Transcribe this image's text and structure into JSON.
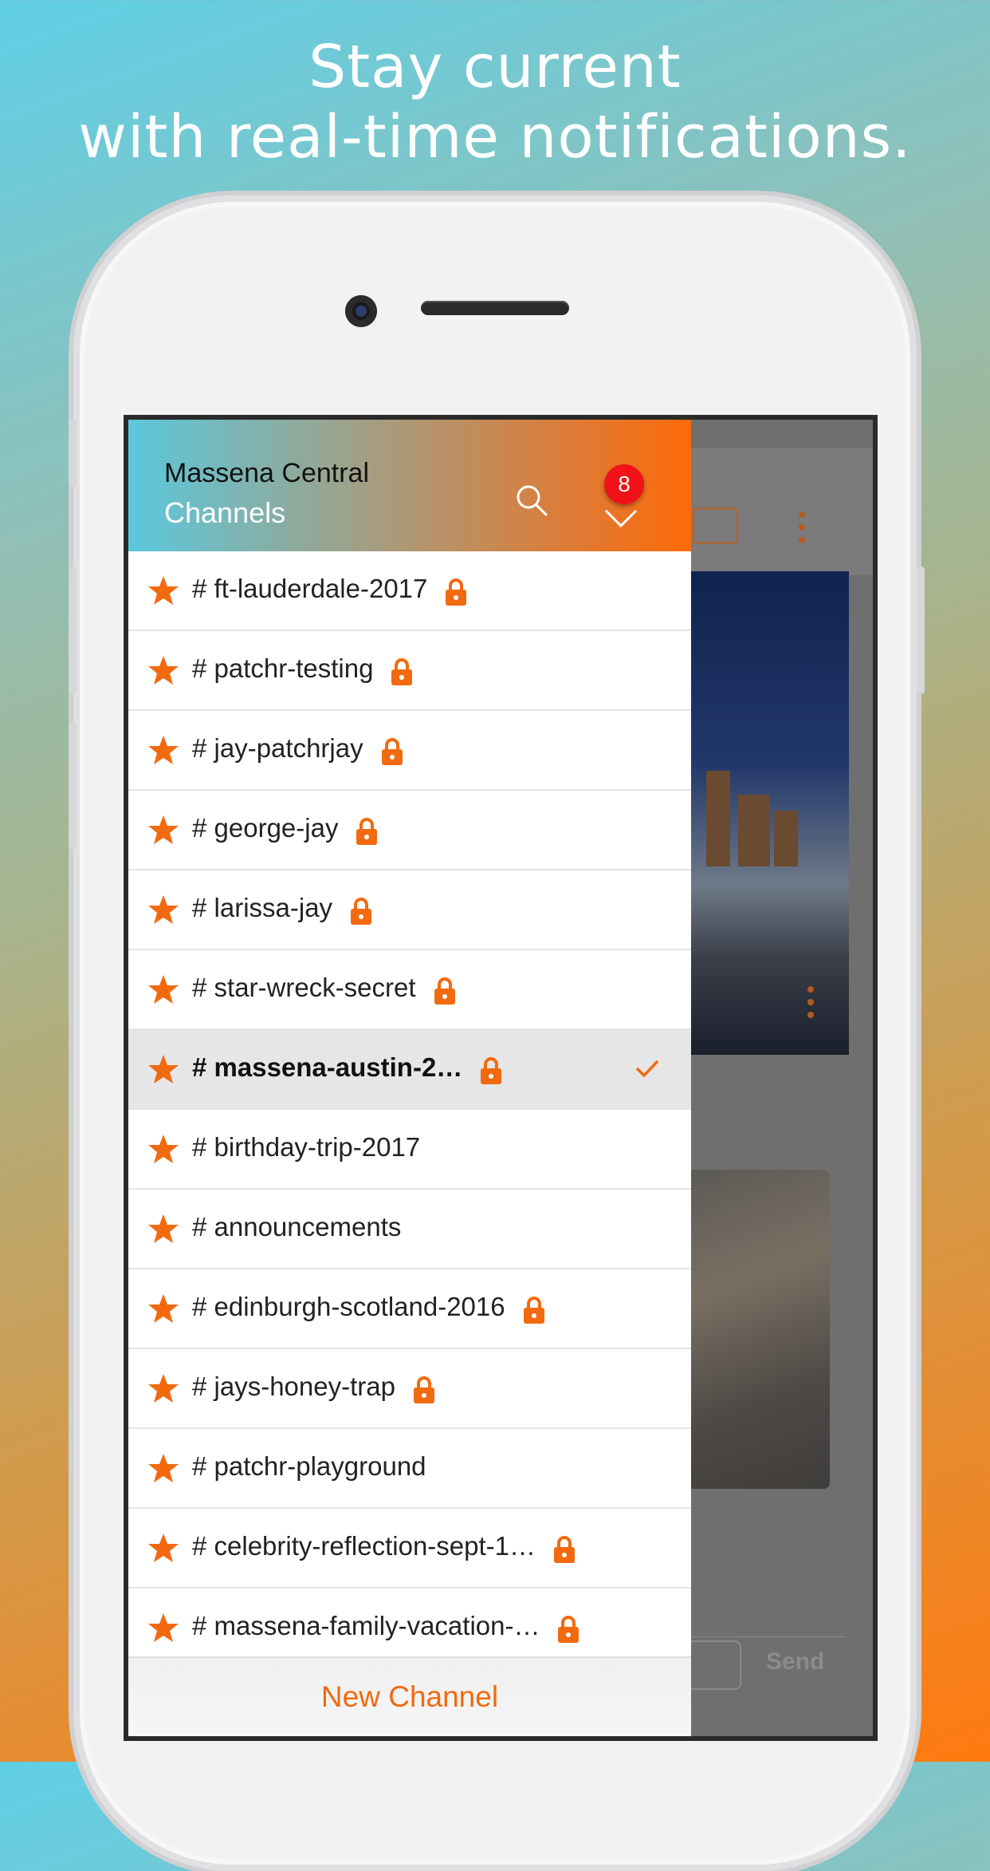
{
  "headline": {
    "line1": "Stay current",
    "line2": "with real-time notifications."
  },
  "drawer": {
    "team_name": "Massena Central",
    "section_title": "Channels",
    "notification_count": "8",
    "new_channel_label": "New Channel"
  },
  "background_app": {
    "send_label": "Send"
  },
  "channels": [
    {
      "label": "# ft-lauderdale-2017",
      "locked": true,
      "selected": false
    },
    {
      "label": "# patchr-testing",
      "locked": true,
      "selected": false
    },
    {
      "label": "# jay-patchrjay",
      "locked": true,
      "selected": false
    },
    {
      "label": "# george-jay",
      "locked": true,
      "selected": false
    },
    {
      "label": "# larissa-jay",
      "locked": true,
      "selected": false
    },
    {
      "label": "# star-wreck-secret",
      "locked": true,
      "selected": false
    },
    {
      "label": "# massena-austin-2…",
      "locked": true,
      "selected": true
    },
    {
      "label": "# birthday-trip-2017",
      "locked": false,
      "selected": false
    },
    {
      "label": "# announcements",
      "locked": false,
      "selected": false
    },
    {
      "label": "# edinburgh-scotland-2016",
      "locked": true,
      "selected": false
    },
    {
      "label": "# jays-honey-trap",
      "locked": true,
      "selected": false
    },
    {
      "label": "# patchr-playground",
      "locked": false,
      "selected": false
    },
    {
      "label": "# celebrity-reflection-sept-1…",
      "locked": true,
      "selected": false
    },
    {
      "label": "# massena-family-vacation-…",
      "locked": true,
      "selected": false
    }
  ],
  "colors": {
    "accent": "#f26a10",
    "badge": "#f01218"
  }
}
